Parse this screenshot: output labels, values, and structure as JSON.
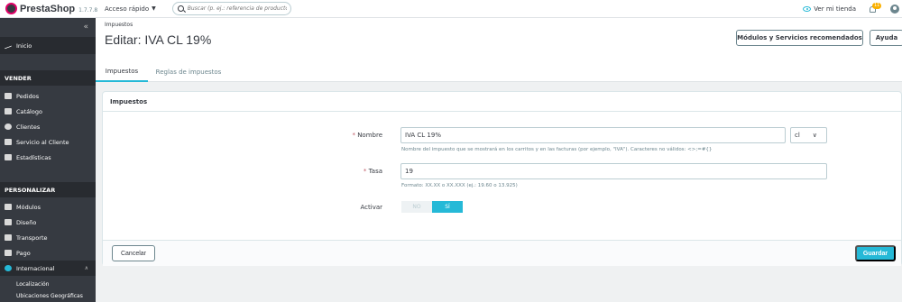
{
  "header": {
    "logo_text": "PrestaShop",
    "version": "1.7.7.8",
    "quick_access": "Acceso rápido",
    "search_placeholder": "Buscar (p. ej.: referencia de producto, n",
    "view_store": "Ver mi tienda",
    "notifications_count": "11"
  },
  "sidebar": {
    "collapse_icon": "«",
    "dashboard": "Inicio",
    "sections": [
      {
        "title": "VENDER",
        "items": [
          "Pedidos",
          "Catálogo",
          "Clientes",
          "Servicio al Cliente",
          "Estadísticas"
        ]
      },
      {
        "title": "PERSONALIZAR",
        "items": [
          "Módulos",
          "Diseño",
          "Transporte",
          "Pago",
          "Internacional"
        ]
      }
    ],
    "active_item": "Internacional",
    "sub_items": [
      "Localización",
      "Ubicaciones Geográficas"
    ]
  },
  "page": {
    "breadcrumb": "Impuestos",
    "title": "Editar: IVA CL 19%",
    "btn_modules": "Módulos y Servicios recomendados",
    "btn_help": "Ayuda",
    "tabs": [
      {
        "label": "Impuestos",
        "active": true
      },
      {
        "label": "Reglas de impuestos",
        "active": false
      }
    ]
  },
  "form": {
    "panel_title": "Impuestos",
    "required_mark": "*",
    "name_label": "Nombre",
    "name_value": "IVA CL 19%",
    "lang_value": "cl",
    "name_help": "Nombre del impuesto que se mostrará en los carritos y en las facturas (por ejemplo, \"IVA\"). Caracteres no válidos: <>;=#{}",
    "rate_label": "Tasa",
    "rate_value": "19",
    "rate_help": "Formato: XX.XX o XX.XXX (ej.: 19.60 o 13.925)",
    "active_label": "Activar",
    "switch_off": "NO",
    "switch_on": "SÍ",
    "active_value": true,
    "cancel": "Cancelar",
    "save": "Guardar"
  },
  "colors": {
    "accent": "#25b9d7",
    "sidebar_bg": "#363a41",
    "badge": "#fab000"
  }
}
